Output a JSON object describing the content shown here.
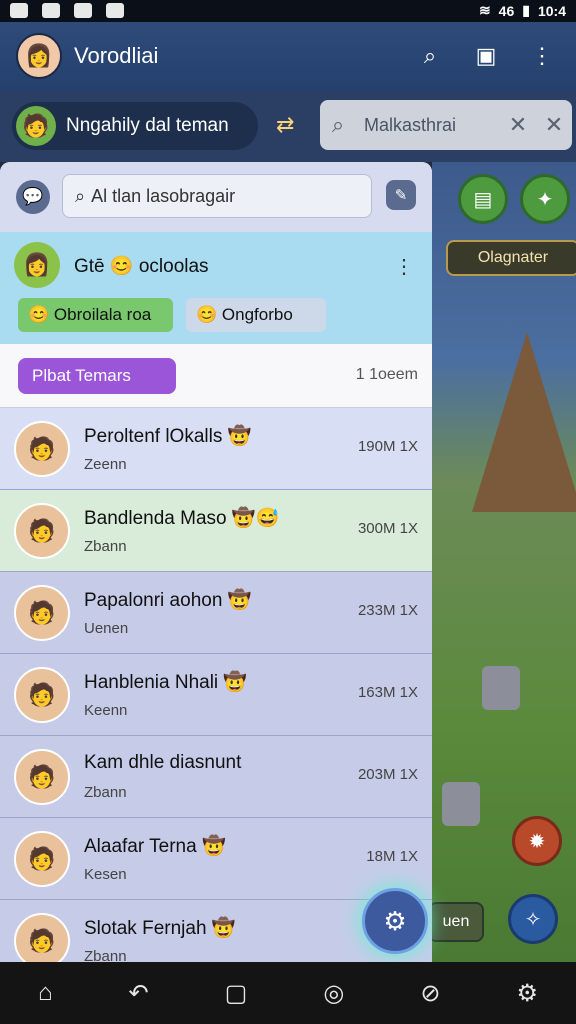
{
  "status_bar": {
    "clock": "10:4",
    "network": "46"
  },
  "app_bar": {
    "title": "Vorodliai"
  },
  "profile_chip": {
    "name": "Nngahily dal teman"
  },
  "top_search": {
    "placeholder": "Malkasthrai"
  },
  "panel": {
    "search_placeholder": "Al tlan lasobragair",
    "group": {
      "title": "Gtē 😊 ocloolas",
      "tag1": "Obroilala roa",
      "tag2": "Ongforbo"
    },
    "tag_button": "Plbat Temars",
    "member_count": "1 1oeem",
    "chats": [
      {
        "name": "Peroltenf lOkalls 🤠",
        "sub": "Zeenn",
        "meta": "190M 1X"
      },
      {
        "name": "Bandlenda Maso 🤠😅",
        "sub": "Zbann",
        "meta": "300M 1X"
      },
      {
        "name": "Papalonri aohon 🤠",
        "sub": "Uenen",
        "meta": "233M 1X"
      },
      {
        "name": "Hanblenia Nhali 🤠",
        "sub": "Keenn",
        "meta": "163M 1X"
      },
      {
        "name": "Kam dhle diasnunt",
        "sub": "Zbann",
        "meta": "203M 1X"
      },
      {
        "name": "Alaafar Terna 🤠",
        "sub": "Kesen",
        "meta": "18M 1X"
      },
      {
        "name": "Slotak Fernjah 🤠",
        "sub": "Zbann",
        "meta": ""
      }
    ]
  },
  "game": {
    "pill": "Olagnater",
    "pill2": "uen"
  }
}
